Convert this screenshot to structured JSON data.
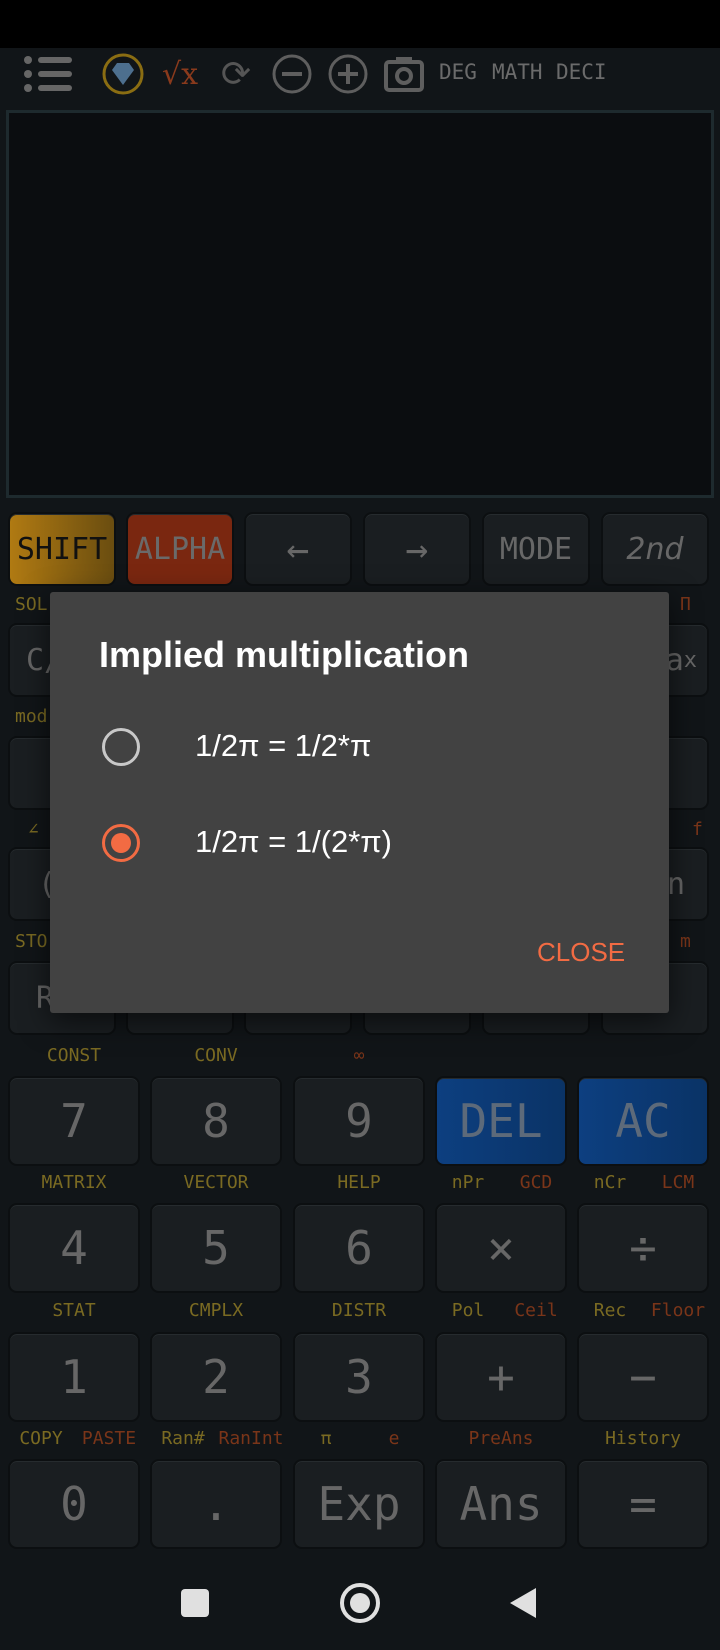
{
  "toolbar": {
    "icons": [
      "menu-icon",
      "premium-diamond-icon",
      "sqrt-x-icon",
      "refresh-icon",
      "zoom-out-icon",
      "zoom-in-icon",
      "camera-icon"
    ],
    "modes": [
      "DEG",
      "MATH",
      "DECI"
    ]
  },
  "top_keys": [
    "SHIFT",
    "ALPHA",
    "←",
    "→",
    "MODE",
    "2nd"
  ],
  "partial": {
    "sol": "SOL",
    "ca": "C/",
    "mod": "mod",
    "angle": "∠",
    "paren": "(",
    "sto": "STO",
    "r": "R",
    "pi_prod": "Π",
    "ax": "a",
    "ax_sup": "x",
    "f": "f",
    "m": "m",
    "n": "n",
    "dot": "."
  },
  "number_labels": [
    [
      {
        "y": "CONST"
      },
      {
        "y": "CONV"
      },
      {
        "r": "∞"
      },
      {},
      {}
    ],
    [
      {
        "y": "MATRIX"
      },
      {
        "y": "VECTOR"
      },
      {
        "y": "HELP"
      },
      {
        "y": "nPr",
        "r": "GCD"
      },
      {
        "y": "nCr",
        "r": "LCM"
      }
    ],
    [
      {
        "y": "STAT"
      },
      {
        "y": "CMPLX"
      },
      {
        "y": "DISTR"
      },
      {
        "y": "Pol",
        "r": "Ceil"
      },
      {
        "y": "Rec",
        "r": "Floor"
      }
    ],
    [
      {
        "y": "COPY",
        "r": "PASTE"
      },
      {
        "y": "Ran#",
        "r": "RanInt"
      },
      {
        "y": "π",
        "r": "e"
      },
      {
        "r": "PreAns"
      },
      {
        "y": "History"
      }
    ]
  ],
  "number_keys": [
    [
      "7",
      "8",
      "9",
      "DEL",
      "AC"
    ],
    [
      "4",
      "5",
      "6",
      "×",
      "÷"
    ],
    [
      "1",
      "2",
      "3",
      "+",
      "−"
    ],
    [
      "0",
      ".",
      "Exp",
      "Ans",
      "="
    ]
  ],
  "dialog": {
    "title": "Implied multiplication",
    "options": [
      {
        "label": "1/2π = 1/2*π",
        "selected": false
      },
      {
        "label": "1/2π = 1/(2*π)",
        "selected": true
      }
    ],
    "close": "CLOSE"
  },
  "colors": {
    "accent": "#f26b43",
    "shift": "#b07a12",
    "alpha": "#8a2a10",
    "del_ac": "#0d3f80"
  }
}
